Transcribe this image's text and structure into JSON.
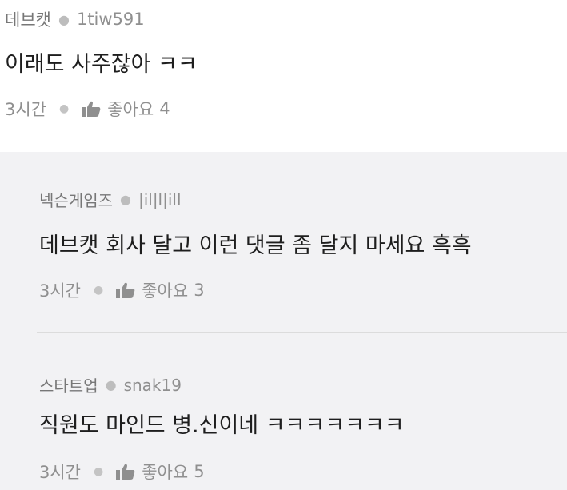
{
  "comments": [
    {
      "author": "데브캣",
      "user_id": "1tiw591",
      "text": "이래도 사주잖아 ㅋㅋ",
      "time": "3시간",
      "like_label": "좋아요",
      "like_count": "4"
    }
  ],
  "replies": [
    {
      "author": "넥슨게임즈",
      "user_id": "|il|l|ill",
      "text": "데브캣 회사 달고 이런 댓글 좀 달지 마세요 흑흑",
      "time": "3시간",
      "like_label": "좋아요",
      "like_count": "3"
    },
    {
      "author": "스타트업",
      "user_id": "snak19",
      "text": "직원도 마인드 병.신이네 ㅋㅋㅋㅋㅋㅋㅋ",
      "time": "3시간",
      "like_label": "좋아요",
      "like_count": "5"
    }
  ],
  "icons": {
    "meta_separator": "dot",
    "like": "thumbs-up-icon"
  },
  "colors": {
    "reply_background": "#f2f2f4",
    "text_primary": "#1e1e1e",
    "text_secondary": "#8f8f8f"
  }
}
